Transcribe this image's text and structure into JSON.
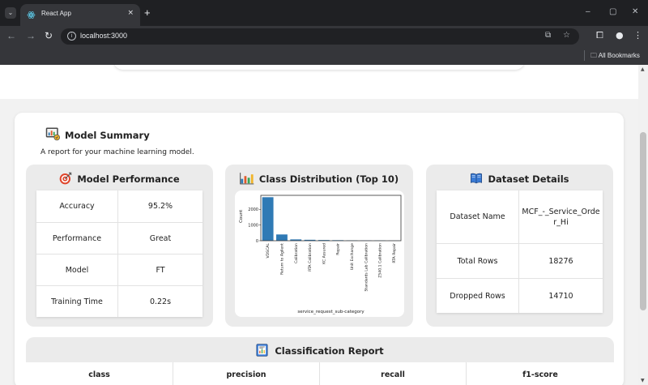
{
  "browser": {
    "tab_title": "React App",
    "tab_close": "×",
    "new_tab": "+",
    "url": "localhost:3000",
    "bookmarks_label": "All Bookmarks",
    "window_controls": [
      "–",
      "▢",
      "✕"
    ]
  },
  "summary": {
    "title": "Model Summary",
    "subtitle": "A report for your machine learning model."
  },
  "performance": {
    "title": "Model Performance",
    "rows": [
      {
        "label": "Accuracy",
        "value": "95.2%"
      },
      {
        "label": "Performance",
        "value": "Great"
      },
      {
        "label": "Model",
        "value": "FT"
      },
      {
        "label": "Training Time",
        "value": "0.22s"
      }
    ]
  },
  "distribution": {
    "title": "Class Distribution (Top 10)"
  },
  "chart_data": {
    "type": "bar",
    "categories": [
      "VDSCAL",
      "Return to Agilent",
      "Calibration",
      "RTA Calibration",
      "KC Assured",
      "Repair",
      "Unit Exchange",
      "Standards Lab Calibration",
      "Z540.1 Calibration",
      "RTA Repair"
    ],
    "values": [
      2780,
      400,
      85,
      60,
      45,
      35,
      25,
      20,
      18,
      12
    ],
    "xlabel": "service_request_sub-category",
    "ylabel": "Count",
    "yticks": [
      "0",
      "1000",
      "2000"
    ],
    "ylim": [
      0,
      2900
    ],
    "color": "#2f7ab5",
    "grid": false
  },
  "dataset": {
    "title": "Dataset Details",
    "rows": [
      {
        "label": "Dataset Name",
        "value": "MCF_-_Service_Order_Hi"
      },
      {
        "label": "Total Rows",
        "value": "18276"
      },
      {
        "label": "Dropped Rows",
        "value": "14710"
      }
    ]
  },
  "report": {
    "title": "Classification Report",
    "columns": [
      "class",
      "precision",
      "recall",
      "f1-score"
    ]
  }
}
